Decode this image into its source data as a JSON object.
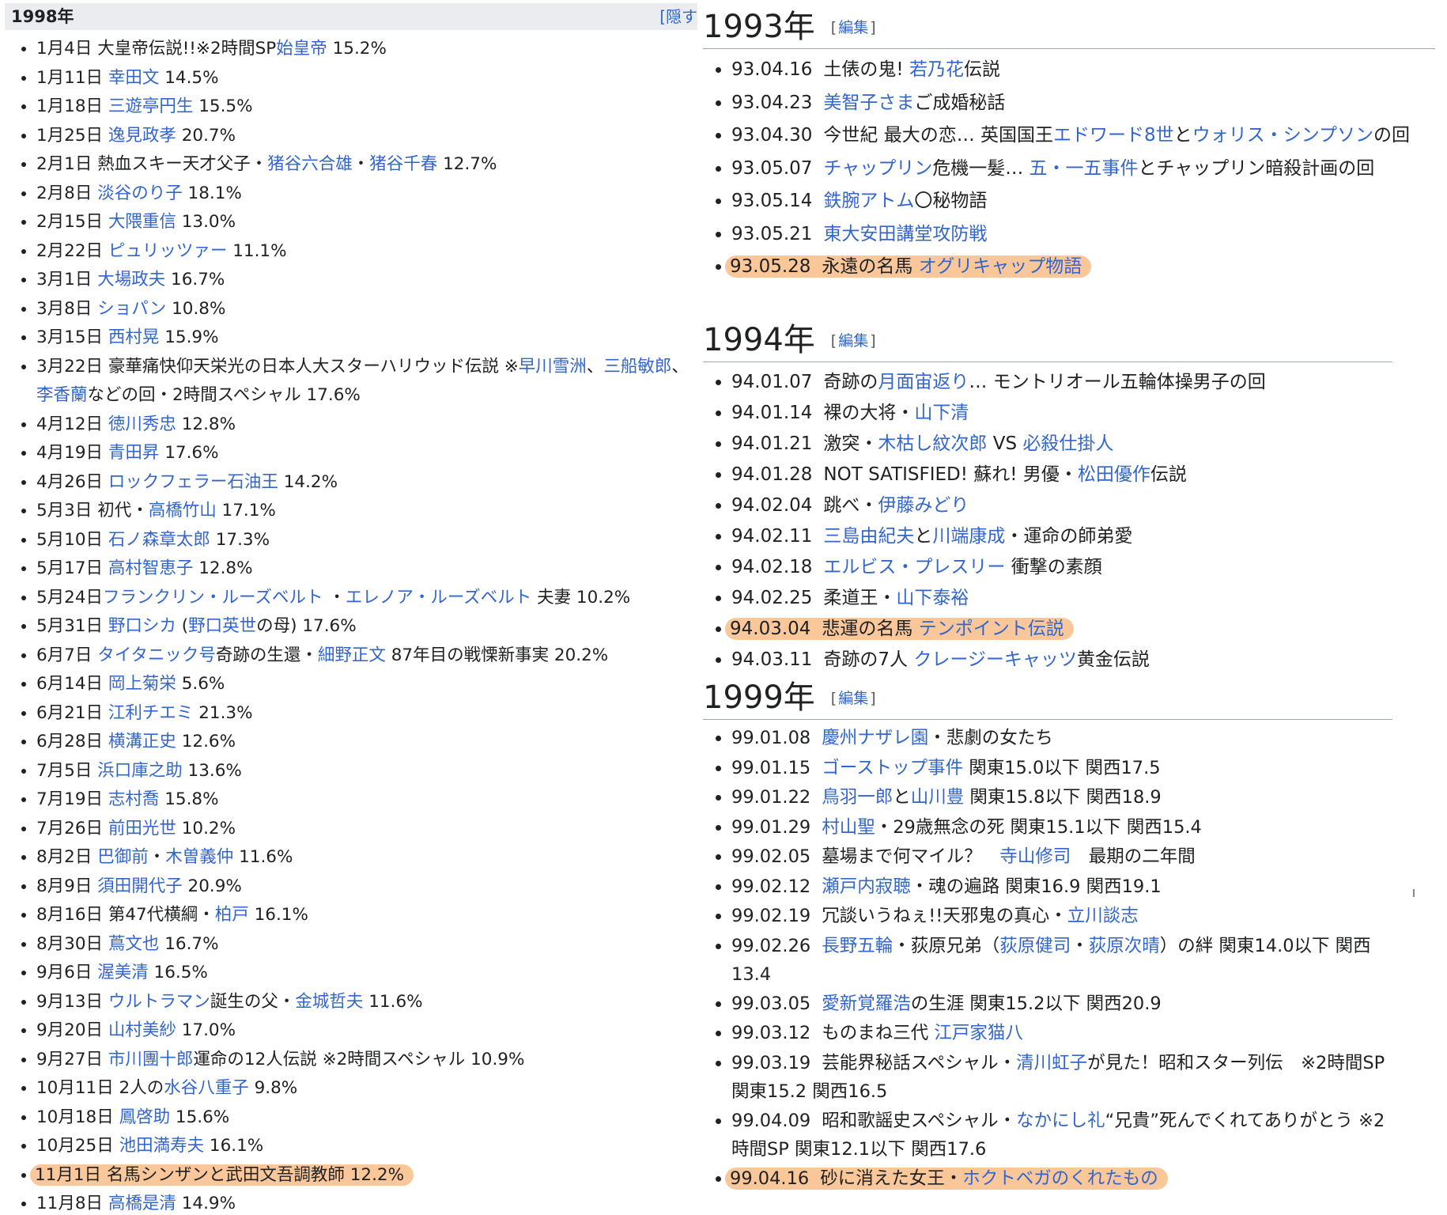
{
  "left": {
    "title": "1998年",
    "toggle": "[隠す",
    "items": [
      {
        "parts": [
          {
            "t": "1月4日 大皇帝伝説!!※2時間SP"
          },
          {
            "t": "始皇帝",
            "link": true
          },
          {
            "t": " 15.2%"
          }
        ]
      },
      {
        "parts": [
          {
            "t": "1月11日 "
          },
          {
            "t": "幸田文",
            "link": true
          },
          {
            "t": " 14.5%"
          }
        ]
      },
      {
        "parts": [
          {
            "t": "1月18日 "
          },
          {
            "t": "三遊亭円生",
            "link": true
          },
          {
            "t": " 15.5%"
          }
        ]
      },
      {
        "parts": [
          {
            "t": "1月25日 "
          },
          {
            "t": "逸見政孝",
            "link": true
          },
          {
            "t": " 20.7%"
          }
        ]
      },
      {
        "parts": [
          {
            "t": "2月1日 熱血スキー天才父子・"
          },
          {
            "t": "猪谷六合雄",
            "link": true
          },
          {
            "t": "・"
          },
          {
            "t": "猪谷千春",
            "link": true
          },
          {
            "t": " 12.7%"
          }
        ]
      },
      {
        "parts": [
          {
            "t": "2月8日 "
          },
          {
            "t": "淡谷のり子",
            "link": true
          },
          {
            "t": " 18.1%"
          }
        ]
      },
      {
        "parts": [
          {
            "t": "2月15日 "
          },
          {
            "t": "大隈重信",
            "link": true
          },
          {
            "t": " 13.0%"
          }
        ]
      },
      {
        "parts": [
          {
            "t": "2月22日 "
          },
          {
            "t": "ピュリッツァー",
            "link": true
          },
          {
            "t": " 11.1%"
          }
        ]
      },
      {
        "parts": [
          {
            "t": "3月1日 "
          },
          {
            "t": "大場政夫",
            "link": true
          },
          {
            "t": " 16.7%"
          }
        ]
      },
      {
        "parts": [
          {
            "t": "3月8日 "
          },
          {
            "t": "ショパン",
            "link": true
          },
          {
            "t": " 10.8%"
          }
        ]
      },
      {
        "parts": [
          {
            "t": "3月15日 "
          },
          {
            "t": "西村晃",
            "link": true
          },
          {
            "t": " 15.9%"
          }
        ]
      },
      {
        "parts": [
          {
            "t": "3月22日 豪華痛快仰天栄光の日本人大スターハリウッド伝説 ※"
          },
          {
            "t": "早川雪洲",
            "link": true
          },
          {
            "t": "、"
          },
          {
            "t": "三船敏郎",
            "link": true
          },
          {
            "t": "、"
          },
          {
            "t": "李香蘭",
            "link": true
          },
          {
            "t": "などの回・2時間スペシャル 17.6%"
          }
        ]
      },
      {
        "parts": [
          {
            "t": "4月12日 "
          },
          {
            "t": "徳川秀忠",
            "link": true
          },
          {
            "t": " 12.8%"
          }
        ]
      },
      {
        "parts": [
          {
            "t": "4月19日 "
          },
          {
            "t": "青田昇",
            "link": true
          },
          {
            "t": " 17.6%"
          }
        ]
      },
      {
        "parts": [
          {
            "t": "4月26日 "
          },
          {
            "t": "ロックフェラー石油王",
            "link": true
          },
          {
            "t": " 14.2%"
          }
        ]
      },
      {
        "parts": [
          {
            "t": "5月3日 初代・"
          },
          {
            "t": "高橋竹山",
            "link": true
          },
          {
            "t": " 17.1%"
          }
        ]
      },
      {
        "parts": [
          {
            "t": "5月10日 "
          },
          {
            "t": "石ノ森章太郎",
            "link": true
          },
          {
            "t": " 17.3%"
          }
        ]
      },
      {
        "parts": [
          {
            "t": "5月17日 "
          },
          {
            "t": "高村智恵子",
            "link": true
          },
          {
            "t": " 12.8%"
          }
        ]
      },
      {
        "parts": [
          {
            "t": "5月24日"
          },
          {
            "t": "フランクリン・ルーズベルト",
            "link": true
          },
          {
            "t": " ・"
          },
          {
            "t": "エレノア・ルーズベルト",
            "link": true
          },
          {
            "t": " 夫妻 10.2%"
          }
        ]
      },
      {
        "parts": [
          {
            "t": "5月31日 "
          },
          {
            "t": "野口シカ",
            "link": true
          },
          {
            "t": " ("
          },
          {
            "t": "野口英世",
            "link": true
          },
          {
            "t": "の母) 17.6%"
          }
        ]
      },
      {
        "parts": [
          {
            "t": "6月7日 "
          },
          {
            "t": "タイタニック号",
            "link": true
          },
          {
            "t": "奇跡の生還・"
          },
          {
            "t": "細野正文",
            "link": true
          },
          {
            "t": " 87年目の戦慄新事実 20.2%"
          }
        ]
      },
      {
        "parts": [
          {
            "t": "6月14日 "
          },
          {
            "t": "岡上菊栄",
            "link": true
          },
          {
            "t": " 5.6%"
          }
        ]
      },
      {
        "parts": [
          {
            "t": "6月21日 "
          },
          {
            "t": "江利チエミ",
            "link": true
          },
          {
            "t": " 21.3%"
          }
        ]
      },
      {
        "parts": [
          {
            "t": "6月28日 "
          },
          {
            "t": "横溝正史",
            "link": true
          },
          {
            "t": " 12.6%"
          }
        ]
      },
      {
        "parts": [
          {
            "t": "7月5日 "
          },
          {
            "t": "浜口庫之助",
            "link": true
          },
          {
            "t": " 13.6%"
          }
        ]
      },
      {
        "parts": [
          {
            "t": "7月19日 "
          },
          {
            "t": "志村喬",
            "link": true
          },
          {
            "t": " 15.8%"
          }
        ]
      },
      {
        "parts": [
          {
            "t": "7月26日 "
          },
          {
            "t": "前田光世",
            "link": true
          },
          {
            "t": " 10.2%"
          }
        ]
      },
      {
        "parts": [
          {
            "t": "8月2日 "
          },
          {
            "t": "巴御前",
            "link": true
          },
          {
            "t": "・"
          },
          {
            "t": "木曽義仲",
            "link": true
          },
          {
            "t": " 11.6%"
          }
        ]
      },
      {
        "parts": [
          {
            "t": "8月9日 "
          },
          {
            "t": "須田開代子",
            "link": true
          },
          {
            "t": " 20.9%"
          }
        ]
      },
      {
        "parts": [
          {
            "t": "8月16日 第47代横綱・"
          },
          {
            "t": "柏戸",
            "link": true
          },
          {
            "t": " 16.1%"
          }
        ]
      },
      {
        "parts": [
          {
            "t": "8月30日 "
          },
          {
            "t": "蔦文也",
            "link": true
          },
          {
            "t": " 16.7%"
          }
        ]
      },
      {
        "parts": [
          {
            "t": "9月6日 "
          },
          {
            "t": "渥美清",
            "link": true
          },
          {
            "t": " 16.5%"
          }
        ]
      },
      {
        "parts": [
          {
            "t": "9月13日 "
          },
          {
            "t": "ウルトラマン",
            "link": true
          },
          {
            "t": "誕生の父・"
          },
          {
            "t": "金城哲夫",
            "link": true
          },
          {
            "t": " 11.6%"
          }
        ]
      },
      {
        "parts": [
          {
            "t": "9月20日 "
          },
          {
            "t": "山村美紗",
            "link": true
          },
          {
            "t": " 17.0%"
          }
        ]
      },
      {
        "parts": [
          {
            "t": "9月27日 "
          },
          {
            "t": "市川團十郎",
            "link": true
          },
          {
            "t": "運命の12人伝説 ※2時間スペシャル 10.9%"
          }
        ]
      },
      {
        "parts": [
          {
            "t": "10月11日 2人の"
          },
          {
            "t": "水谷八重子",
            "link": true
          },
          {
            "t": " 9.8%"
          }
        ]
      },
      {
        "parts": [
          {
            "t": "10月18日 "
          },
          {
            "t": "鳳啓助",
            "link": true
          },
          {
            "t": " 15.6%"
          }
        ]
      },
      {
        "parts": [
          {
            "t": "10月25日 "
          },
          {
            "t": "池田満寿夫",
            "link": true
          },
          {
            "t": " 16.1%"
          }
        ]
      },
      {
        "highlight": true,
        "parts": [
          {
            "t": "11月1日 名馬シンザンと武田文吾調教師 12.2%"
          }
        ]
      },
      {
        "parts": [
          {
            "t": "11月8日 "
          },
          {
            "t": "高橋是清",
            "link": true
          },
          {
            "t": " 14.9%"
          }
        ]
      }
    ]
  },
  "sections": [
    {
      "id": "sec1993",
      "year": "1993年",
      "edit": "編集",
      "items": [
        {
          "date": "93.04.16",
          "parts": [
            {
              "t": "土俵の鬼! "
            },
            {
              "t": "若乃花",
              "link": true
            },
            {
              "t": "伝説"
            }
          ]
        },
        {
          "date": "93.04.23",
          "parts": [
            {
              "t": "美智子さま",
              "link": true
            },
            {
              "t": "ご成婚秘話"
            }
          ]
        },
        {
          "date": "93.04.30",
          "parts": [
            {
              "t": "今世紀 最大の恋… 英国国王"
            },
            {
              "t": "エドワード8世",
              "link": true
            },
            {
              "t": "と"
            },
            {
              "t": "ウォリス・シンプソン",
              "link": true
            },
            {
              "t": "の回"
            }
          ]
        },
        {
          "date": "93.05.07",
          "parts": [
            {
              "t": "チャップリン",
              "link": true
            },
            {
              "t": "危機一髪… "
            },
            {
              "t": "五・一五事件",
              "link": true
            },
            {
              "t": "とチャップリン暗殺計画の回"
            }
          ]
        },
        {
          "date": "93.05.14",
          "parts": [
            {
              "t": "鉄腕アトム",
              "link": true
            },
            {
              "t": "〇秘物語"
            }
          ]
        },
        {
          "date": "93.05.21",
          "parts": [
            {
              "t": "東大安田講堂攻防戦",
              "link": true
            }
          ]
        },
        {
          "date": "93.05.28",
          "highlight": true,
          "parts": [
            {
              "t": "永遠の名馬 "
            },
            {
              "t": "オグリキャップ物語",
              "link": true
            }
          ]
        }
      ]
    },
    {
      "id": "sec1994",
      "year": "1994年",
      "edit": "編集",
      "items": [
        {
          "date": "94.01.07",
          "parts": [
            {
              "t": "奇跡の"
            },
            {
              "t": "月面宙返り",
              "link": true
            },
            {
              "t": "… モントリオール五輪体操男子の回"
            }
          ]
        },
        {
          "date": "94.01.14",
          "parts": [
            {
              "t": "裸の大将・"
            },
            {
              "t": "山下清",
              "link": true
            }
          ]
        },
        {
          "date": "94.01.21",
          "parts": [
            {
              "t": "激突・"
            },
            {
              "t": "木枯し紋次郎",
              "link": true
            },
            {
              "t": " VS "
            },
            {
              "t": "必殺仕掛人",
              "link": true
            }
          ]
        },
        {
          "date": "94.01.28",
          "parts": [
            {
              "t": "NOT SATISFIED! 蘇れ! 男優・"
            },
            {
              "t": "松田優作",
              "link": true
            },
            {
              "t": "伝説"
            }
          ]
        },
        {
          "date": "94.02.04",
          "parts": [
            {
              "t": "跳べ・"
            },
            {
              "t": "伊藤みどり",
              "link": true
            }
          ]
        },
        {
          "date": "94.02.11",
          "parts": [
            {
              "t": "三島由紀夫",
              "link": true
            },
            {
              "t": "と"
            },
            {
              "t": "川端康成",
              "link": true
            },
            {
              "t": "・運命の師弟愛"
            }
          ]
        },
        {
          "date": "94.02.18",
          "parts": [
            {
              "t": "エルビス・プレスリー",
              "link": true
            },
            {
              "t": " 衝撃の素顔"
            }
          ]
        },
        {
          "date": "94.02.25",
          "parts": [
            {
              "t": "柔道王・"
            },
            {
              "t": "山下泰裕",
              "link": true
            }
          ]
        },
        {
          "date": "94.03.04",
          "highlight": true,
          "parts": [
            {
              "t": "悲運の名馬 "
            },
            {
              "t": "テンポイント伝説",
              "link": true
            }
          ]
        },
        {
          "date": "94.03.11",
          "parts": [
            {
              "t": "奇跡の7人 "
            },
            {
              "t": "クレージーキャッツ",
              "link": true
            },
            {
              "t": "黄金伝説"
            }
          ]
        }
      ]
    },
    {
      "id": "sec1999",
      "year": "1999年",
      "edit": "編集",
      "items": [
        {
          "date": "99.01.08",
          "parts": [
            {
              "t": "慶州ナザレ園",
              "link": true
            },
            {
              "t": "・悲劇の女たち"
            }
          ]
        },
        {
          "date": "99.01.15",
          "parts": [
            {
              "t": "ゴーストップ事件",
              "link": true
            },
            {
              "t": " 関東15.0以下 関西17.5"
            }
          ]
        },
        {
          "date": "99.01.22",
          "parts": [
            {
              "t": "鳥羽一郎",
              "link": true
            },
            {
              "t": "と"
            },
            {
              "t": "山川豊",
              "link": true
            },
            {
              "t": " 関東15.8以下 関西18.9"
            }
          ]
        },
        {
          "date": "99.01.29",
          "parts": [
            {
              "t": "村山聖",
              "link": true
            },
            {
              "t": "・29歳無念の死 関東15.1以下 関西15.4"
            }
          ]
        },
        {
          "date": "99.02.05",
          "parts": [
            {
              "t": "墓場まで何マイル？　"
            },
            {
              "t": "寺山修司",
              "link": true
            },
            {
              "t": "　最期の二年間"
            }
          ]
        },
        {
          "date": "99.02.12",
          "parts": [
            {
              "t": "瀬戸内寂聴",
              "link": true
            },
            {
              "t": "・魂の遍路 関東16.9 関西19.1"
            }
          ]
        },
        {
          "date": "99.02.19",
          "parts": [
            {
              "t": "冗談いうねぇ!!天邪鬼の真心・"
            },
            {
              "t": "立川談志",
              "link": true
            }
          ]
        },
        {
          "date": "99.02.26",
          "two": true,
          "parts": [
            {
              "t": "長野五輪",
              "link": true
            },
            {
              "t": "・荻原兄弟（"
            },
            {
              "t": "荻原健司",
              "link": true
            },
            {
              "t": "・"
            },
            {
              "t": "荻原次晴",
              "link": true
            },
            {
              "t": "）の絆 関東14.0以下 関西13.4"
            }
          ]
        },
        {
          "date": "99.03.05",
          "parts": [
            {
              "t": "愛新覚羅浩",
              "link": true
            },
            {
              "t": "の生涯 関東15.2以下 関西20.9"
            }
          ]
        },
        {
          "date": "99.03.12",
          "parts": [
            {
              "t": "ものまね三代 "
            },
            {
              "t": "江戸家猫八",
              "link": true
            }
          ]
        },
        {
          "date": "99.03.19",
          "two": true,
          "parts": [
            {
              "t": "芸能界秘話スペシャル・"
            },
            {
              "t": "清川虹子",
              "link": true
            },
            {
              "t": "が見た！昭和スター列伝　※2時間SP 関東15.2 関西16.5"
            }
          ]
        },
        {
          "date": "99.04.09",
          "two": true,
          "parts": [
            {
              "t": "昭和歌謡史スペシャル・"
            },
            {
              "t": "なかにし礼",
              "link": true
            },
            {
              "t": "“兄貴”死んでくれてありがとう ※2時間SP 関東12.1以下 関西17.6"
            }
          ]
        },
        {
          "date": "99.04.16",
          "highlight": true,
          "parts": [
            {
              "t": "砂に消えた女王・"
            },
            {
              "t": "ホクトベガのくれたもの",
              "link": true
            }
          ]
        }
      ]
    }
  ]
}
